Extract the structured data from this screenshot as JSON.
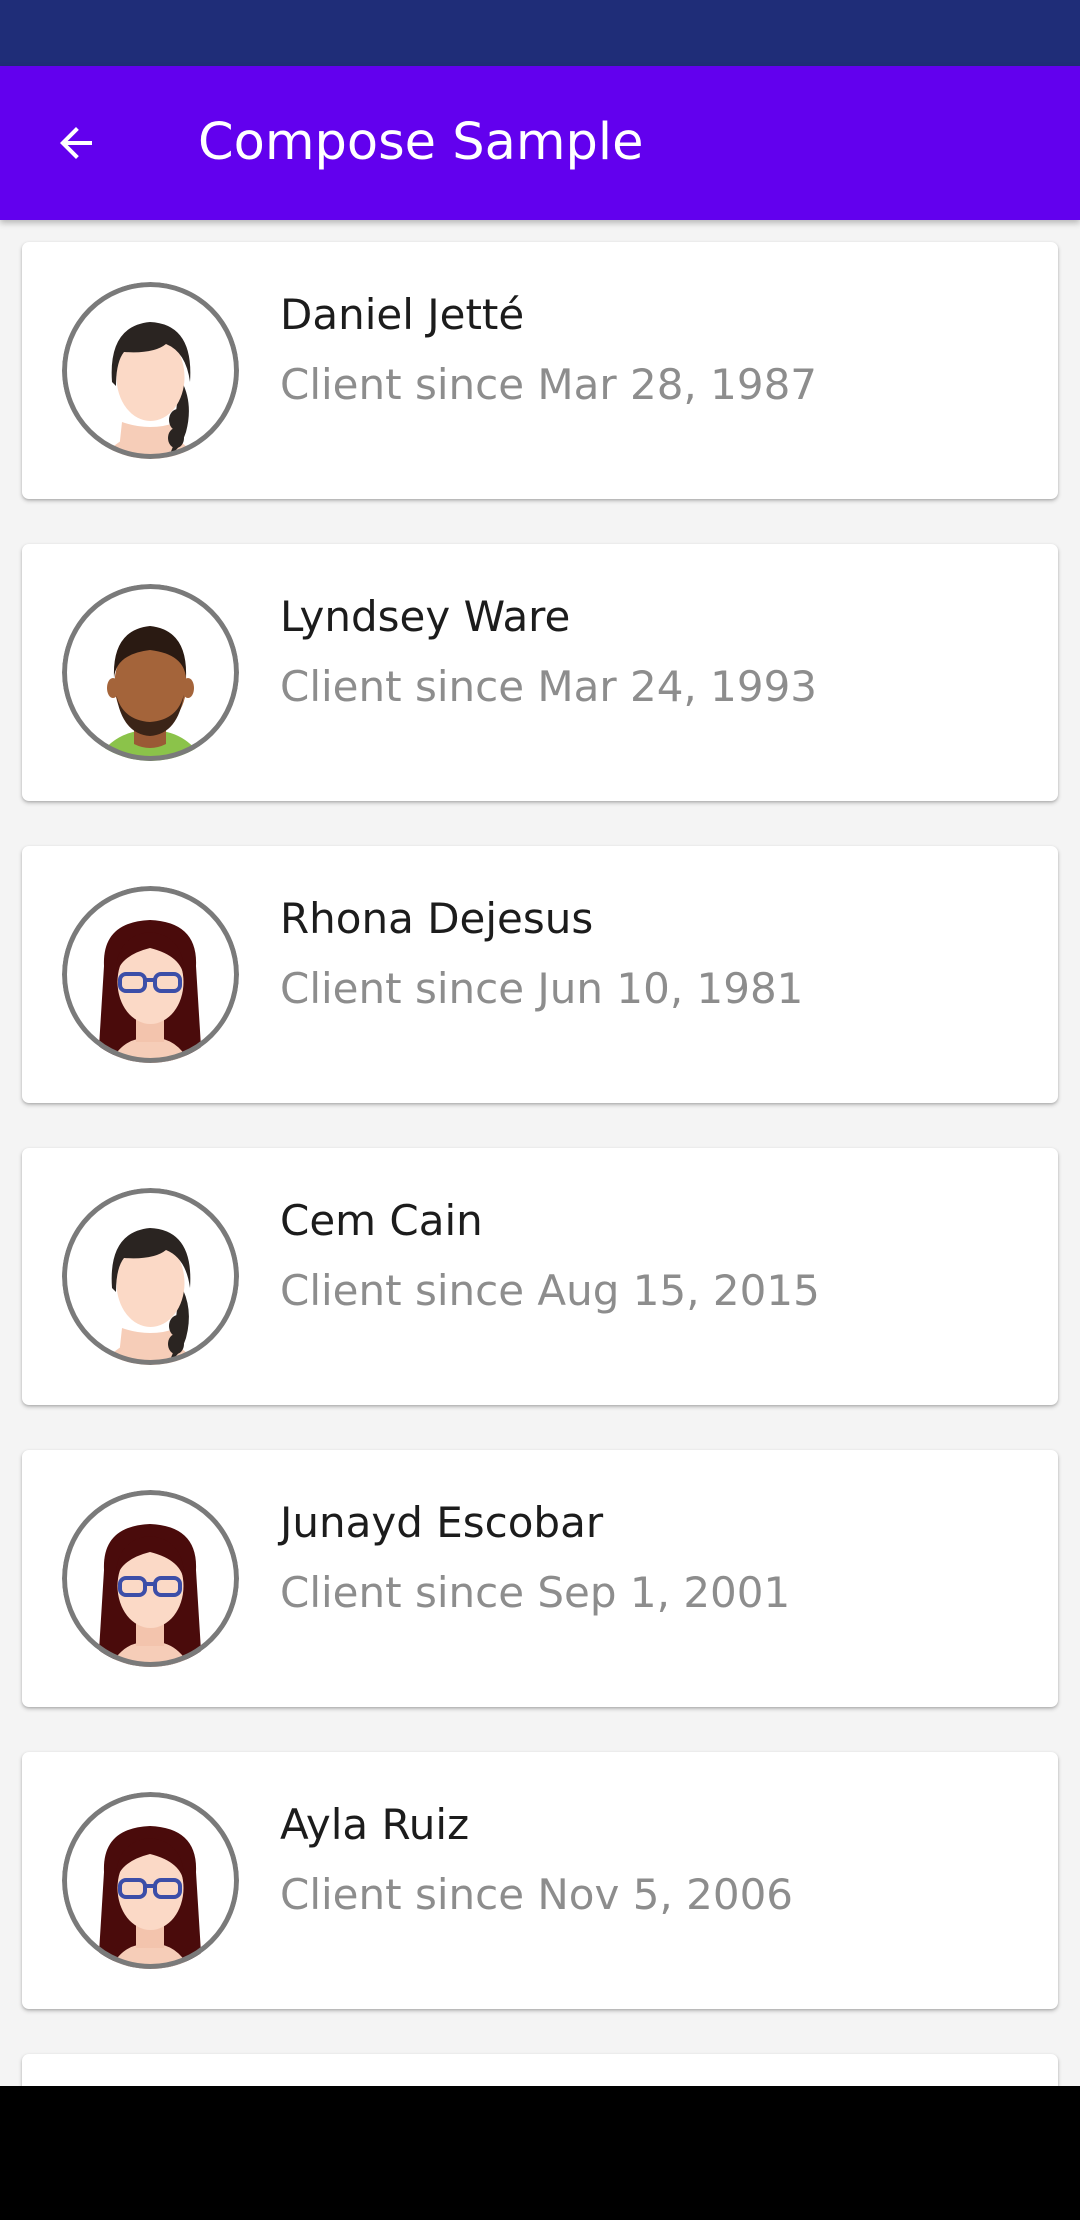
{
  "app_bar": {
    "title": "Compose Sample",
    "back_icon": "arrow-back-icon"
  },
  "colors": {
    "status_bar": "#1f2d78",
    "app_bar": "#6200ee",
    "navigation_bar": "#000000"
  },
  "clients": [
    {
      "name": "Daniel Jetté",
      "since": "Client since Mar 28, 1987",
      "avatar": "woman-braid-avatar-icon"
    },
    {
      "name": "Lyndsey Ware",
      "since": "Client since Mar 24, 1993",
      "avatar": "man-beard-avatar-icon"
    },
    {
      "name": "Rhona Dejesus",
      "since": "Client since Jun 10, 1981",
      "avatar": "woman-glasses-avatar-icon"
    },
    {
      "name": "Cem Cain",
      "since": "Client since Aug 15, 2015",
      "avatar": "woman-braid-avatar-icon"
    },
    {
      "name": "Junayd Escobar",
      "since": "Client since Sep 1, 2001",
      "avatar": "woman-glasses-avatar-icon"
    },
    {
      "name": "Ayla Ruiz",
      "since": "Client since Nov 5, 2006",
      "avatar": "woman-glasses-avatar-icon"
    }
  ]
}
